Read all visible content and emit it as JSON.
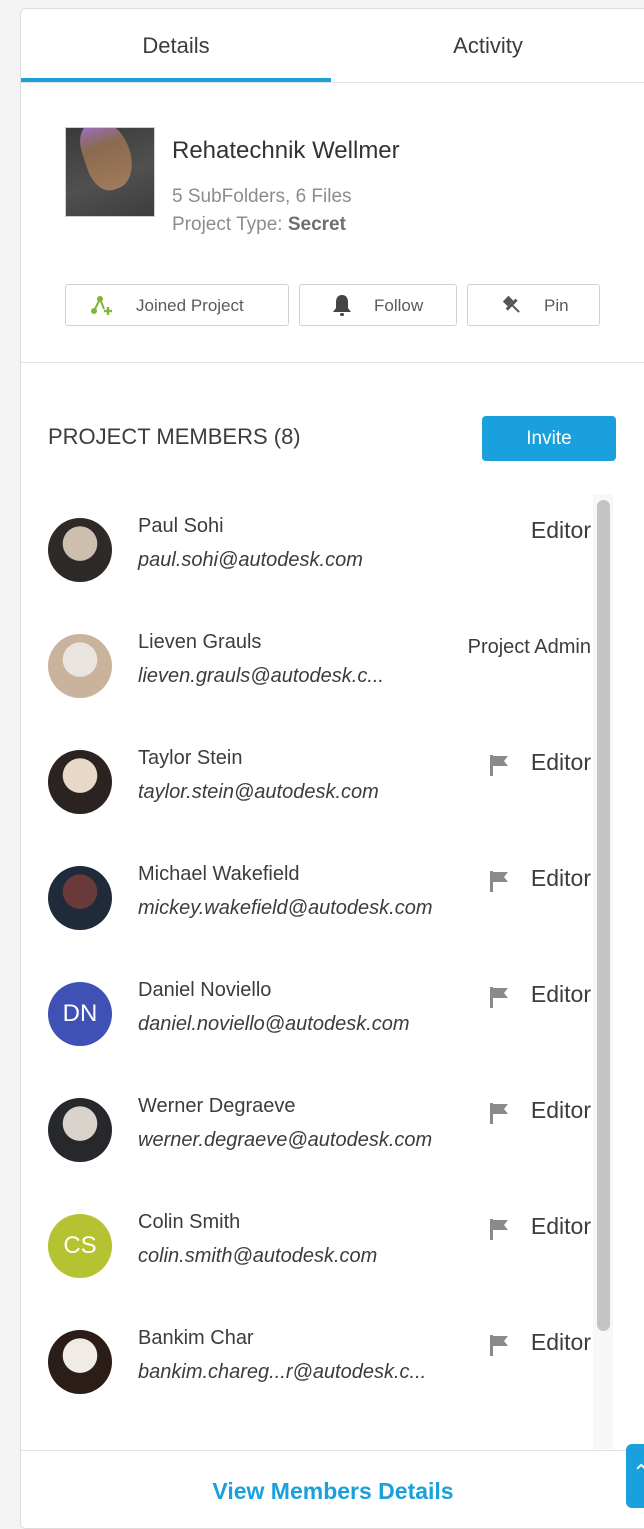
{
  "tabs": [
    {
      "label": "Details",
      "active": true
    },
    {
      "label": "Activity",
      "active": false
    }
  ],
  "project": {
    "name": "Rehatechnik Wellmer",
    "contents": "5 SubFolders, 6 Files",
    "type_label": "Project Type:",
    "type_value": "Secret",
    "buttons": {
      "joined": "Joined Project",
      "follow": "Follow",
      "pin": "Pin"
    }
  },
  "members": {
    "title": "PROJECT MEMBERS (8)",
    "invite_label": "Invite",
    "list": [
      {
        "name": "Paul Sohi",
        "email": "paul.sohi@autodesk.com",
        "role": "Editor",
        "flag": false,
        "avatar": "photo"
      },
      {
        "name": "Lieven Grauls",
        "email": "lieven.grauls@autodesk.c...",
        "role": "Project Admin",
        "flag": false,
        "avatar": "photo"
      },
      {
        "name": "Taylor Stein",
        "email": "taylor.stein@autodesk.com",
        "role": "Editor",
        "flag": true,
        "avatar": "photo"
      },
      {
        "name": "Michael Wakefield",
        "email": "mickey.wakefield@autodesk.com",
        "role": "Editor",
        "flag": true,
        "avatar": "photo"
      },
      {
        "name": "Daniel Noviello",
        "email": "daniel.noviello@autodesk.com",
        "role": "Editor",
        "flag": true,
        "avatar": "initials",
        "initials": "DN",
        "color": "#3f51b5"
      },
      {
        "name": "Werner Degraeve",
        "email": "werner.degraeve@autodesk.com",
        "role": "Editor",
        "flag": true,
        "avatar": "photo"
      },
      {
        "name": "Colin Smith",
        "email": "colin.smith@autodesk.com",
        "role": "Editor",
        "flag": true,
        "avatar": "initials",
        "initials": "CS",
        "color": "#b5c232"
      },
      {
        "name": "Bankim Char",
        "email": "bankim.chareg...r@autodesk.c...",
        "role": "Editor",
        "flag": true,
        "avatar": "photo"
      }
    ]
  },
  "footer": {
    "link_label": "View Members Details"
  },
  "colors": {
    "accent": "#1aa0dc",
    "joined_icon": "#7cb833"
  },
  "icons": {
    "joined": "user-add-icon",
    "follow": "bell-icon",
    "pin": "pin-icon",
    "role_flag": "flag-icon",
    "side_tab": "chevron-up-icon"
  }
}
